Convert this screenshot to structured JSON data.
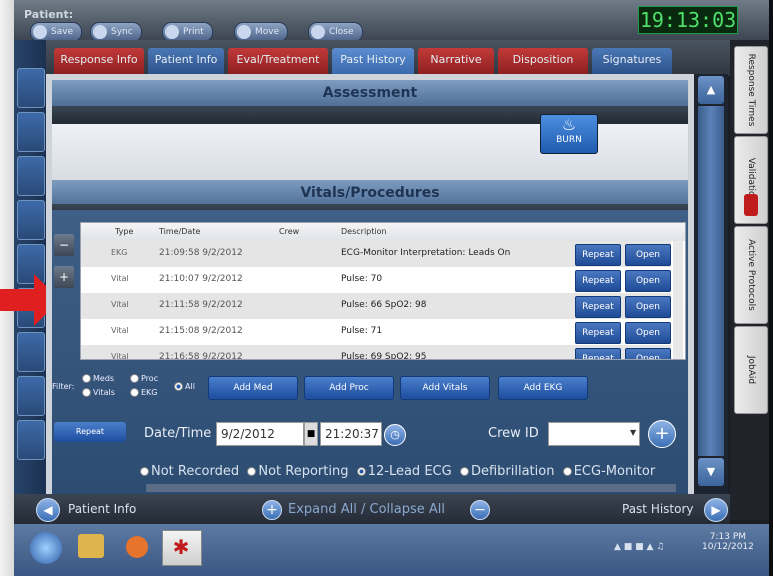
{
  "window": {
    "patient_label": "Patient:",
    "clock": "19:13:03"
  },
  "toolbar": {
    "items": [
      "Save",
      "Sync",
      "Print",
      "Move",
      "Close"
    ]
  },
  "tabs": [
    {
      "label": "Response Info",
      "style": "red"
    },
    {
      "label": "Patient Info",
      "style": "blue"
    },
    {
      "label": "Eval/Treatment",
      "style": "red"
    },
    {
      "label": "Past History",
      "style": "active"
    },
    {
      "label": "Narrative",
      "style": "red"
    },
    {
      "label": "Disposition",
      "style": "red"
    },
    {
      "label": "Signatures",
      "style": "blue"
    }
  ],
  "right_tabs": [
    "Response Times",
    "Validation",
    "Active Protocols",
    "JobAid"
  ],
  "assessment": {
    "title": "Assessment",
    "burn_label": "BURN"
  },
  "vitals": {
    "title": "Vitals/Procedures",
    "columns": [
      "Type",
      "Time/Date",
      "Crew",
      "Description"
    ],
    "rows": [
      {
        "type": "EKG",
        "time": "21:09:58 9/2/2012",
        "desc": "ECG-Monitor Interpretation: Leads On",
        "repeat": "Repeat",
        "open": "Open"
      },
      {
        "type": "Vital",
        "time": "21:10:07 9/2/2012",
        "desc": "Pulse: 70",
        "repeat": "Repeat",
        "open": "Open"
      },
      {
        "type": "Vital",
        "time": "21:11:58 9/2/2012",
        "desc": "Pulse: 66 SpO2: 98",
        "repeat": "Repeat",
        "open": "Open"
      },
      {
        "type": "Vital",
        "time": "21:15:08 9/2/2012",
        "desc": "Pulse: 71",
        "repeat": "Repeat",
        "open": "Open"
      },
      {
        "type": "Vital",
        "time": "21:16:58 9/2/2012",
        "desc": "Pulse: 69 SpO2: 95",
        "repeat": "Repeat",
        "open": "Open"
      }
    ],
    "side_minus": "−",
    "side_plus": "+"
  },
  "filter": {
    "label": "Filter:",
    "meds": "Meds",
    "proc": "Proc",
    "vitals": "Vitals",
    "ekg": "EKG",
    "all": "All",
    "selected": "All"
  },
  "actions": {
    "add_med": "Add Med",
    "add_proc": "Add Proc",
    "add_vitals": "Add Vitals",
    "add_ekg": "Add EKG"
  },
  "entry": {
    "repeat": "Repeat",
    "datetime_label": "Date/Time",
    "date": "9/2/2012",
    "time": "21:20:37",
    "crew_label": "Crew ID",
    "crew_value": ""
  },
  "options": {
    "items": [
      "Not Recorded",
      "Not Reporting",
      "12-Lead ECG",
      "Defibrillation",
      "ECG-Monitor"
    ],
    "selected": "12-Lead ECG"
  },
  "footer": {
    "prev": "Patient Info",
    "expand": "Expand All / Collapse All",
    "next": "Past History"
  },
  "taskbar": {
    "time": "7:13 PM",
    "date": "10/12/2012"
  },
  "colors": {
    "clock_green": "#4fe06a",
    "arrow_red": "#e02020",
    "button_blue": "#1f4b96"
  }
}
